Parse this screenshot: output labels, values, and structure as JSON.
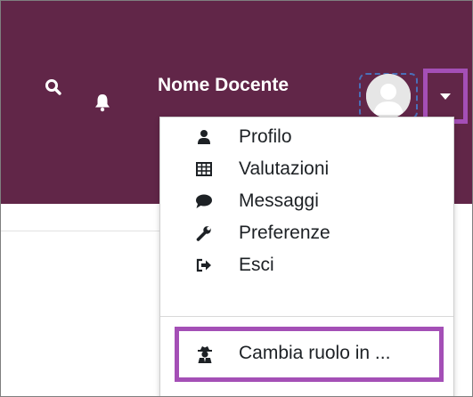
{
  "navbar": {
    "search_icon": "search-icon",
    "notifications_icon": "bell-icon",
    "user_name": "Nome Docente",
    "avatar_icon": "user-avatar",
    "dropdown_icon": "caret-down-icon",
    "background_color": "#612648",
    "highlight_color": "#a44fb6"
  },
  "user_menu": {
    "items": [
      {
        "label": "Profilo",
        "icon": "user-icon"
      },
      {
        "label": "Valutazioni",
        "icon": "table-icon"
      },
      {
        "label": "Messaggi",
        "icon": "comment-icon"
      },
      {
        "label": "Preferenze",
        "icon": "wrench-icon"
      },
      {
        "label": "Esci",
        "icon": "sign-out-icon"
      }
    ],
    "switch_role": {
      "label": "Cambia ruolo in ...",
      "icon": "user-secret-icon"
    }
  }
}
